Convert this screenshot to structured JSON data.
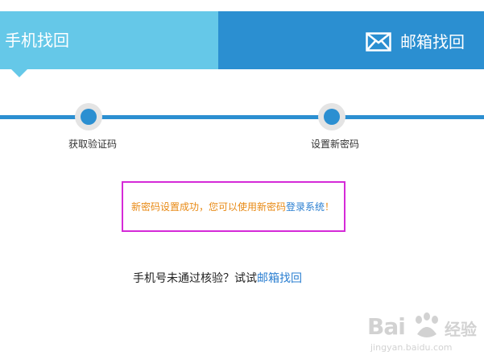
{
  "tabs": {
    "phone_label": "手机找回",
    "email_label": "邮箱找回",
    "email_icon": "envelope-icon"
  },
  "steps": [
    {
      "label": "获取验证码"
    },
    {
      "label": "设置新密码"
    }
  ],
  "message": {
    "before": "新密码设置成功，您可以使用新密码",
    "link": "登录系统",
    "after": "！"
  },
  "hint": {
    "text": "手机号未通过核验？试试",
    "link": "邮箱找回"
  },
  "watermark": {
    "brand": "Bai",
    "brand2": "经验",
    "url": "jingyan.baidu.com"
  },
  "colors": {
    "tab_light": "#65c8e8",
    "tab_dark": "#2b8fd1",
    "message_text": "#e88a15",
    "link": "#2b7fd1",
    "highlight_border": "#d52ad8"
  }
}
